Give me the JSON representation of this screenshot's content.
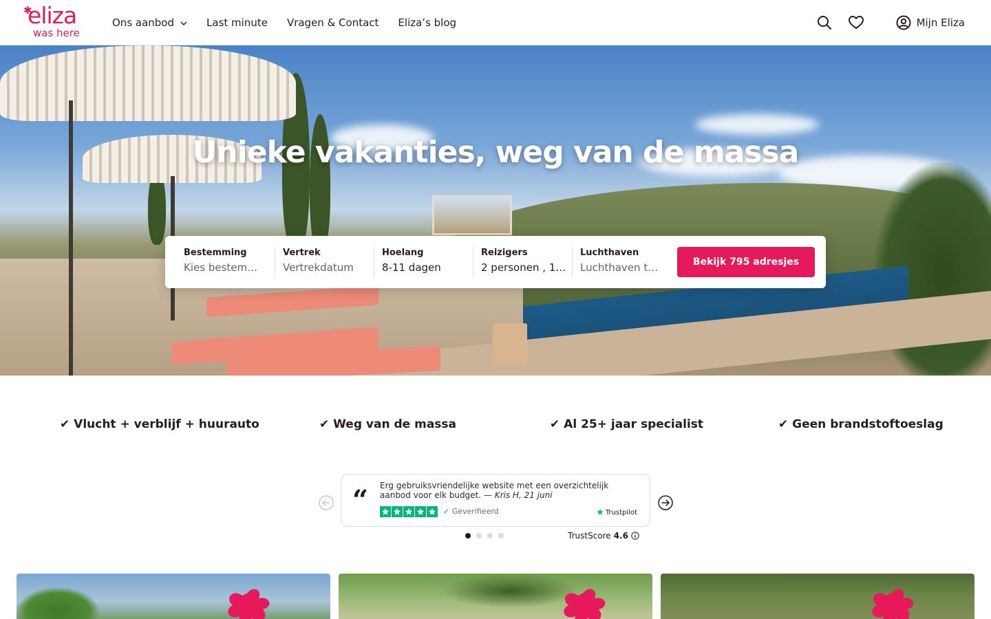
{
  "nav": {
    "logo_line1": "eliza",
    "logo_line2": "was here",
    "menu": [
      {
        "label": "Ons aanbod",
        "has_dropdown": true
      },
      {
        "label": "Last minute"
      },
      {
        "label": "Vragen & Contact"
      },
      {
        "label": "Eliza’s blog"
      }
    ],
    "search_icon": "search-icon",
    "favorites_icon": "heart-icon",
    "account_icon": "user-circle-icon",
    "account_label": "Mijn Eliza"
  },
  "hero": {
    "title": "Unieke vakanties, weg van de massa"
  },
  "search": {
    "fields": [
      {
        "label": "Bestemming",
        "value": "Kies bestem…"
      },
      {
        "label": "Vertrek",
        "value": "Vertrekdatum"
      },
      {
        "label": "Hoelang",
        "value": "8-11 dagen"
      },
      {
        "label": "Reizigers",
        "value": "2 personen , 1…"
      },
      {
        "label": "Luchthaven",
        "value": "Luchthaven t…"
      }
    ],
    "cta": "Bekijk 795 adresjes"
  },
  "usps": [
    "✔ Vlucht + verblijf + huurauto",
    "✔ Weg van de massa",
    "✔ Al 25+ jaar specialist",
    "✔ Geen brandstoftoeslag"
  ],
  "review": {
    "quote_glyph": "“",
    "text": "Erg gebruiksvriendelijke website met een overzichtelijk aanbod voor elk budget. —",
    "author": "Kris H, 21 juni",
    "verified": "Geverifieerd",
    "brand": "Trustpilot",
    "trustscore_label": "TrustScore",
    "trustscore_value": "4.6",
    "dots": 4,
    "active_dot": 1
  },
  "colors": {
    "brand": "#e6195b",
    "trustpilot_green": "#00b67a",
    "text": "#2b1a20"
  }
}
